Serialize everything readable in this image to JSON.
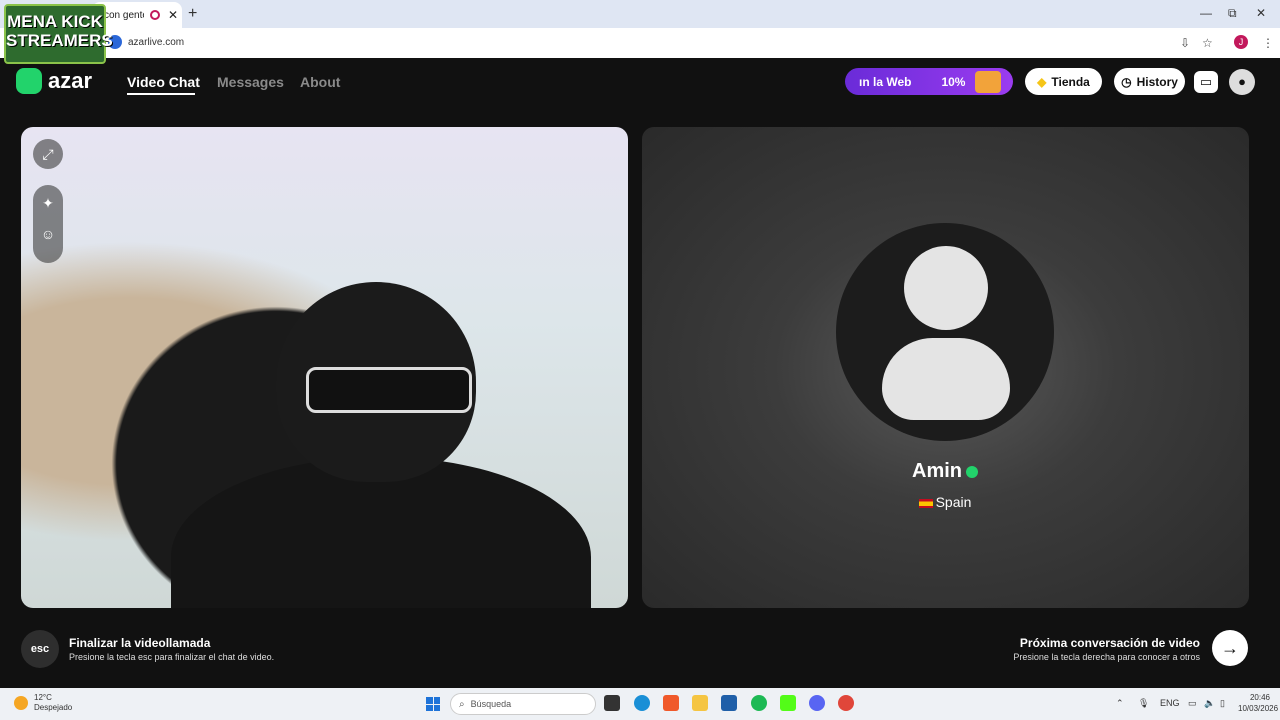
{
  "browser": {
    "tab_title": "con gente",
    "url": "azarlive.com",
    "overlay_logo_line1": "MENA KICK",
    "overlay_logo_line2": "STREAMERS",
    "new_tab": "+",
    "close_tab": "✕",
    "window_minimize": "—",
    "window_restore": "⧉",
    "window_close": "✕",
    "profile_initial": "J"
  },
  "app": {
    "brand": "azar",
    "nav": [
      "Video Chat",
      "Messages",
      "About"
    ],
    "promo_text_a": "ın la Web",
    "promo_text_b": "10%",
    "tienda_label": "Tienda",
    "history_label": "History"
  },
  "peer": {
    "name": "Amin",
    "country": "Spain"
  },
  "footer": {
    "esc_key": "esc",
    "end_title": "Finalizar la videollamada",
    "end_sub": "Presione la tecla esc para finalizar el chat de video.",
    "next_title": "Próxima conversación de video",
    "next_sub": "Presione la tecla derecha para conocer a otros",
    "next_arrow": "→"
  },
  "taskbar": {
    "temp": "12°C",
    "weather": "Despejado",
    "search_placeholder": "Búsqueda",
    "lang": "ENG",
    "time": "20:46",
    "date": "10/03/2026"
  }
}
